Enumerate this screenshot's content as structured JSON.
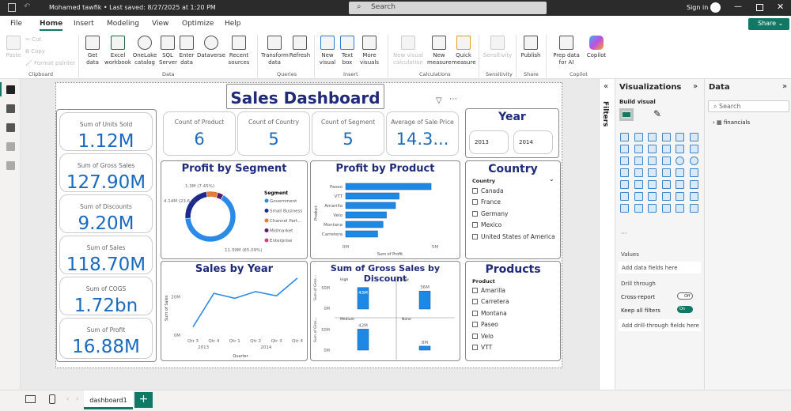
{
  "titlebar": {
    "title": "Mohamed tawfik • Last saved: 8/27/2025 at 1:20 PM",
    "search": "Search",
    "sign_in": "Sign in"
  },
  "menu_tabs": [
    "File",
    "Home",
    "Insert",
    "Modeling",
    "View",
    "Optimize",
    "Help"
  ],
  "share": "Share",
  "ribbon": {
    "clipboard": {
      "paste": "Paste",
      "cut": "Cut",
      "copy": "Copy",
      "format_painter": "Format painter",
      "group": "Clipboard"
    },
    "data": {
      "items": [
        "Get data",
        "Excel workbook",
        "OneLake catalog",
        "SQL Server",
        "Enter data",
        "Dataverse",
        "Recent sources"
      ],
      "group": "Data"
    },
    "queries": {
      "items": [
        "Transform data",
        "Refresh"
      ],
      "group": "Queries"
    },
    "insert": {
      "items": [
        "New visual",
        "Text box",
        "More visuals"
      ],
      "group": "Insert"
    },
    "calculations": {
      "items": [
        "New visual calculation",
        "New measure",
        "Quick measure"
      ],
      "group": "Calculations"
    },
    "sensitivity": {
      "items": [
        "Sensitivity"
      ],
      "group": "Sensitivity"
    },
    "share": {
      "items": [
        "Publish"
      ],
      "group": "Share"
    },
    "copilot": {
      "items": [
        "Prep data for AI",
        "Copilot"
      ],
      "group": "Copilot"
    }
  },
  "dashboard": {
    "title": "Sales Dashboard",
    "side_cards": [
      {
        "label": "Sum of Units Sold",
        "value": "1.12M"
      },
      {
        "label": "Sum of Gross Sales",
        "value": "127.90M"
      },
      {
        "label": "Sum of Discounts",
        "value": "9.20M"
      },
      {
        "label": "Sum of Sales",
        "value": "118.70M"
      },
      {
        "label": "Sum of COGS",
        "value": "1.72bn"
      },
      {
        "label": "Sum of Profit",
        "value": "16.88M"
      }
    ],
    "kpis": [
      {
        "label": "Count of Product",
        "value": "6"
      },
      {
        "label": "Count of Country",
        "value": "5"
      },
      {
        "label": "Count of Segment",
        "value": "5"
      },
      {
        "label": "Average of Sale Price",
        "value": "14.3..."
      }
    ],
    "year": {
      "title": "Year",
      "options": [
        "2013",
        "2014"
      ]
    },
    "country": {
      "title": "Country",
      "header": "Country",
      "items": [
        "Canada",
        "France",
        "Germany",
        "Mexico",
        "United States of America"
      ]
    },
    "products": {
      "title": "Products",
      "header": "Product",
      "items": [
        "Amarilla",
        "Carretera",
        "Montana",
        "Paseo",
        "Velo",
        "VTT"
      ]
    }
  },
  "chart_data": [
    {
      "id": "segment",
      "type": "pie",
      "title": "Profit by Segment",
      "legend_title": "Segment",
      "legend_placement": "right",
      "labels": [
        "Government",
        "Small Business",
        "Channel Part...",
        "Midmarket",
        "Enterprise"
      ],
      "values": [
        11.39,
        4.14,
        1.3,
        0.66,
        0.02
      ],
      "colors": [
        "#2b8ae6",
        "#1c2a8c",
        "#e07b39",
        "#5a1a6b",
        "#c4487f"
      ],
      "data_labels": [
        "11.39M (65.09%)",
        "4.14M (23.6...)",
        "1.3M (7.45%)"
      ]
    },
    {
      "id": "product",
      "type": "bar",
      "title": "Profit by Product",
      "categories": [
        "Paseo",
        "VTT",
        "Amarilla",
        "Velo",
        "Montana",
        "Carretera"
      ],
      "values": [
        4.78,
        2.99,
        2.79,
        2.28,
        2.09,
        1.79
      ],
      "xlabel": "Sum of Profit",
      "ylabel": "Product",
      "xlim": [
        0,
        5
      ],
      "xticks": [
        "0M",
        "5M"
      ],
      "color": "#1e88e5"
    },
    {
      "id": "year",
      "type": "line",
      "title": "Sales by Year",
      "categories": [
        "Qtr 3",
        "Qtr 4",
        "Qtr 1",
        "Qtr 2",
        "Qtr 3",
        "Qtr 4"
      ],
      "groups": [
        "2013",
        "2014"
      ],
      "values": [
        4.3,
        21.7,
        19.1,
        22.6,
        20.4,
        29.6
      ],
      "ylim": [
        0,
        32
      ],
      "yticks": [
        "0M",
        "20M"
      ],
      "xlabel": "Quarter",
      "ylabel": "Sum of Sales",
      "color": "#2b8ae6"
    },
    {
      "id": "discount",
      "type": "bar",
      "title": "Sum of Gross Sales by Discount",
      "ylabel": "Sum of Gros...",
      "yticks": [
        "0M",
        "50M"
      ],
      "ylim": [
        0,
        60
      ],
      "panels": [
        {
          "name": "High",
          "value": 43,
          "label": "43M"
        },
        {
          "name": "Low",
          "value": 36,
          "label": "36M"
        },
        {
          "name": "Medium",
          "value": 42,
          "label": "42M"
        },
        {
          "name": "None",
          "value": 8,
          "label": "8M"
        }
      ],
      "color": "#1e88e5"
    }
  ],
  "filters_label": "Filters",
  "visualizations": {
    "title": "Visualizations",
    "build": "Build visual",
    "values": "Values",
    "add_fields": "Add data fields here",
    "drill": "Drill through",
    "cross": "Cross-report",
    "cross_state": "Off",
    "keep": "Keep all filters",
    "keep_state": "On",
    "add_drill": "Add drill-through fields here"
  },
  "data_pane": {
    "title": "Data",
    "search": "Search",
    "table": "financials"
  },
  "bottom": {
    "page_tab": "dashboard1"
  }
}
